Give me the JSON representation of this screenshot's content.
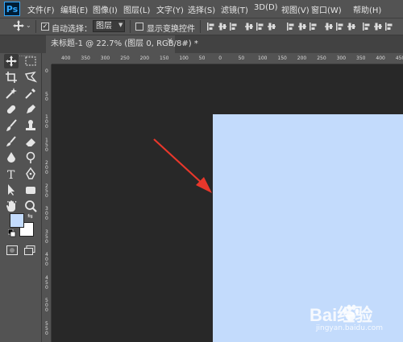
{
  "app": {
    "logo_text": "Ps"
  },
  "menu": {
    "items": [
      "文件(F)",
      "编辑(E)",
      "图像(I)",
      "图层(L)",
      "文字(Y)",
      "选择(S)",
      "滤镜(T)",
      "3D(D)",
      "视图(V)",
      "窗口(W)",
      "帮助(H)"
    ]
  },
  "options_bar": {
    "auto_select_label": "自动选择：",
    "auto_select_checked": true,
    "auto_select_target": "图层",
    "show_transform_label": "显示变换控件",
    "show_transform_checked": false
  },
  "document_tab": {
    "title": "未标题-1 @ 22.7% (图层 0, RGB/8#) *",
    "close_symbol": "×"
  },
  "rulers": {
    "top_labels": [
      "400",
      "350",
      "300",
      "250",
      "200",
      "150",
      "100",
      "50",
      "0",
      "50",
      "100",
      "150",
      "200",
      "250",
      "300",
      "350",
      "400",
      "450"
    ],
    "left_labels": [
      "0",
      "5 0",
      "1 0 0",
      "1 5 0",
      "2 0 0",
      "2 5 0",
      "3 0 0",
      "3 5 0",
      "4 0 0",
      "4 5 0",
      "5 0 0",
      "5 5 0"
    ]
  },
  "canvas": {
    "fill_color": "#c3dbfc",
    "pasteboard_color": "#282828"
  },
  "colors": {
    "foreground": "#c3dbfc",
    "background": "#ffffff",
    "arrow": "#e8372b",
    "accent": "#31a8ff"
  },
  "watermark": {
    "brand": "Bai经验",
    "url": "jingyan.baidu.com"
  }
}
